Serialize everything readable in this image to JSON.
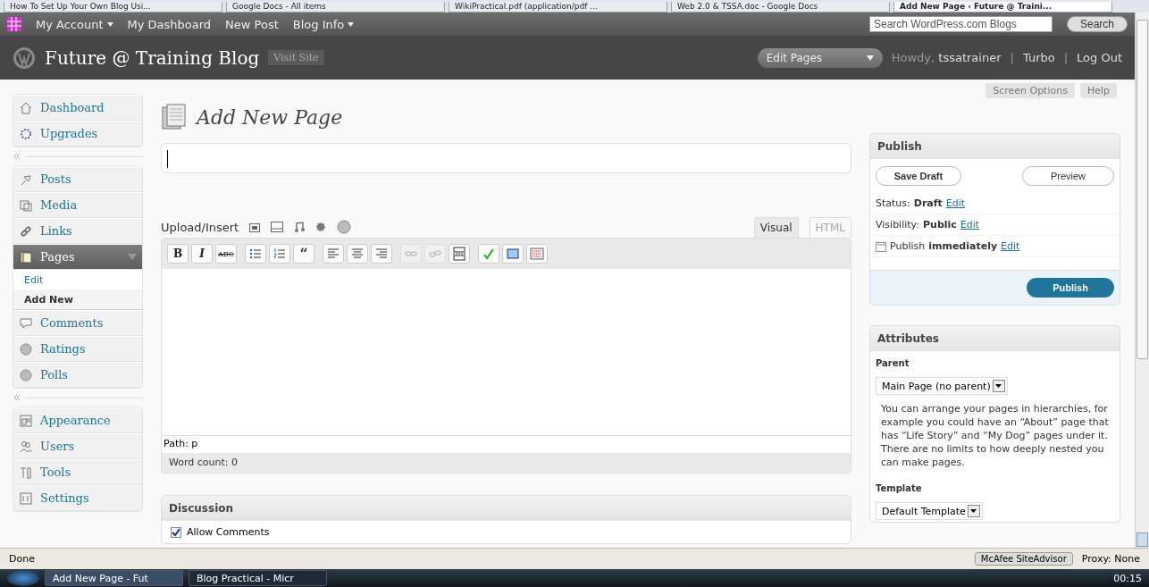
{
  "browser_tabs": [
    {
      "label": "How To Set Up Your Own Blog Usi...",
      "selected": false
    },
    {
      "label": "Google Docs - All items",
      "selected": false
    },
    {
      "label": "WikiPractical.pdf (application/pdf ...",
      "selected": false
    },
    {
      "label": "Web 2.0 & TSSA.doc - Google Docs",
      "selected": false
    },
    {
      "label": "Add New Page ‹ Future @ Traini...",
      "selected": true
    }
  ],
  "wpcom_bar": {
    "menu": [
      {
        "label": "My Account",
        "dropdown": true
      },
      {
        "label": "My Dashboard",
        "dropdown": false
      },
      {
        "label": "New Post",
        "dropdown": false
      },
      {
        "label": "Blog Info",
        "dropdown": true
      }
    ],
    "search_placeholder": "Search WordPress.com Blogs",
    "search_button": "Search"
  },
  "header": {
    "blog_title": "Future @ Training Blog",
    "visit_site": "Visit Site",
    "favorite_action": "Edit Pages",
    "howdy": "Howdy,",
    "user": "tssatrainer",
    "separator": "|",
    "links": [
      "Turbo",
      "Log Out"
    ]
  },
  "screen_meta": [
    "Screen Options",
    "Help"
  ],
  "sidebar": {
    "groups": [
      [
        {
          "label": "Dashboard",
          "expanded": false
        },
        {
          "label": "Upgrades",
          "expanded": false
        }
      ],
      [
        {
          "label": "Posts",
          "expanded": false
        },
        {
          "label": "Media",
          "expanded": false
        },
        {
          "label": "Links",
          "expanded": false
        },
        {
          "label": "Pages",
          "expanded": true,
          "children": [
            {
              "label": "Edit",
              "selected": false
            },
            {
              "label": "Add New",
              "selected": true
            }
          ]
        },
        {
          "label": "Comments",
          "expanded": false
        },
        {
          "label": "Ratings",
          "expanded": false
        },
        {
          "label": "Polls",
          "expanded": false
        }
      ],
      [
        {
          "label": "Appearance",
          "expanded": false
        },
        {
          "label": "Users",
          "expanded": false
        },
        {
          "label": "Tools",
          "expanded": false
        },
        {
          "label": "Settings",
          "expanded": false
        }
      ]
    ]
  },
  "page_title": "Add New Page",
  "editor": {
    "upload_label": "Upload/Insert",
    "tabs": [
      {
        "label": "Visual",
        "selected": true
      },
      {
        "label": "HTML",
        "selected": false
      }
    ],
    "toolbar": [
      {
        "kind": "text",
        "label": "B"
      },
      {
        "kind": "text",
        "label": "I"
      },
      {
        "kind": "text",
        "label": "ABC"
      },
      {
        "kind": "icon",
        "disabled": false
      },
      {
        "kind": "icon",
        "disabled": false
      },
      {
        "kind": "text",
        "label": "“"
      },
      {
        "kind": "icon",
        "disabled": false
      },
      {
        "kind": "icon",
        "disabled": false
      },
      {
        "kind": "icon",
        "disabled": false
      },
      {
        "kind": "icon",
        "disabled": true
      },
      {
        "kind": "icon",
        "disabled": true
      },
      {
        "kind": "icon",
        "disabled": false
      },
      {
        "kind": "icon",
        "disabled": false
      },
      {
        "kind": "icon",
        "disabled": false
      },
      {
        "kind": "icon",
        "disabled": false
      }
    ],
    "path": "Path: p",
    "word_count": "Word count: 0"
  },
  "discussion": {
    "title": "Discussion",
    "options": [
      {
        "label": "Allow Comments",
        "checked": true
      }
    ]
  },
  "publish": {
    "title": "Publish",
    "save_draft": "Save Draft",
    "preview": "Preview",
    "rows": [
      {
        "label": "Status:",
        "value": "Draft",
        "link": "Edit"
      },
      {
        "label": "Visibility:",
        "value": "Public",
        "link": "Edit"
      },
      {
        "label": "Publish",
        "value": "immediately",
        "link": "Edit"
      }
    ],
    "publish_button": "Publish"
  },
  "attributes": {
    "title": "Attributes",
    "parent_label": "Parent",
    "parent_value": "Main Page (no parent)",
    "help": "You can arrange your pages in hierarchies, for example you could have an “About” page that has “Life Story” and “My Dog” pages under it. There are no limits to how deeply nested you can make pages.",
    "template_label": "Template",
    "template_value": "Default Template"
  },
  "status_bar": {
    "text": "Done",
    "addon": "McAfee SiteAdvisor",
    "proxy": "Proxy: None"
  },
  "taskbar": {
    "windows": [
      {
        "label": "Add New Page - Fut",
        "selected": true
      },
      {
        "label": "Blog Practical - Micr",
        "selected": false
      }
    ],
    "clock": "00:15"
  }
}
